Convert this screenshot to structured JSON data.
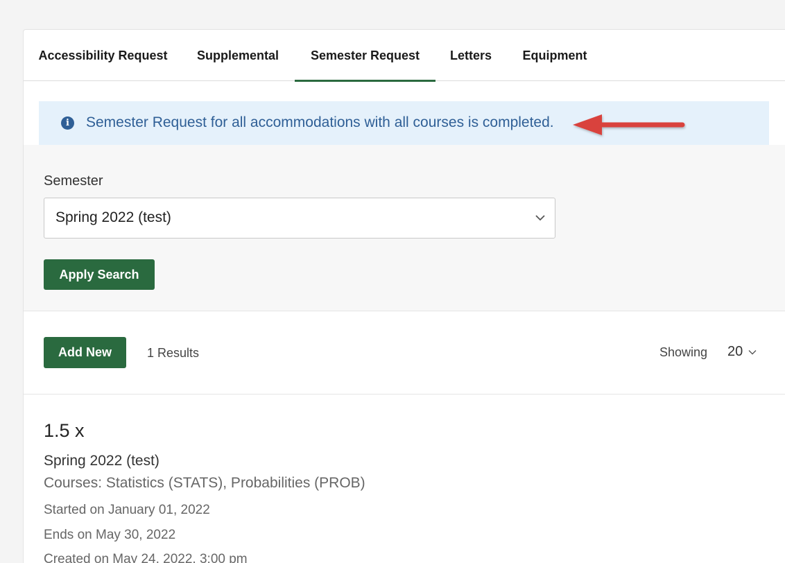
{
  "tabs": [
    {
      "label": "Accessibility Request",
      "active": false
    },
    {
      "label": "Supplemental",
      "active": false
    },
    {
      "label": "Semester Request",
      "active": true
    },
    {
      "label": "Letters",
      "active": false
    },
    {
      "label": "Equipment",
      "active": false
    }
  ],
  "alert": {
    "icon": "info-icon",
    "text": "Semester Request for all accommodations with all courses is completed."
  },
  "filter": {
    "semester_label": "Semester",
    "semester_value": "Spring 2022 (test)",
    "apply_label": "Apply Search"
  },
  "results": {
    "add_label": "Add New",
    "count": "1 Results",
    "showing_label": "Showing",
    "per_page": "20"
  },
  "item": {
    "title": "1.5 x",
    "semester": "Spring 2022 (test)",
    "courses": "Courses: Statistics (STATS), Probabilities (PROB)",
    "started": "Started on January 01, 2022",
    "ends": "Ends on May 30, 2022",
    "created": "Created on May 24, 2022, 3:00 pm"
  },
  "colors": {
    "brand_green": "#2a6a3f",
    "alert_bg": "#e5f1fb",
    "alert_text": "#2f5f96",
    "arrow": "#d9433d"
  }
}
